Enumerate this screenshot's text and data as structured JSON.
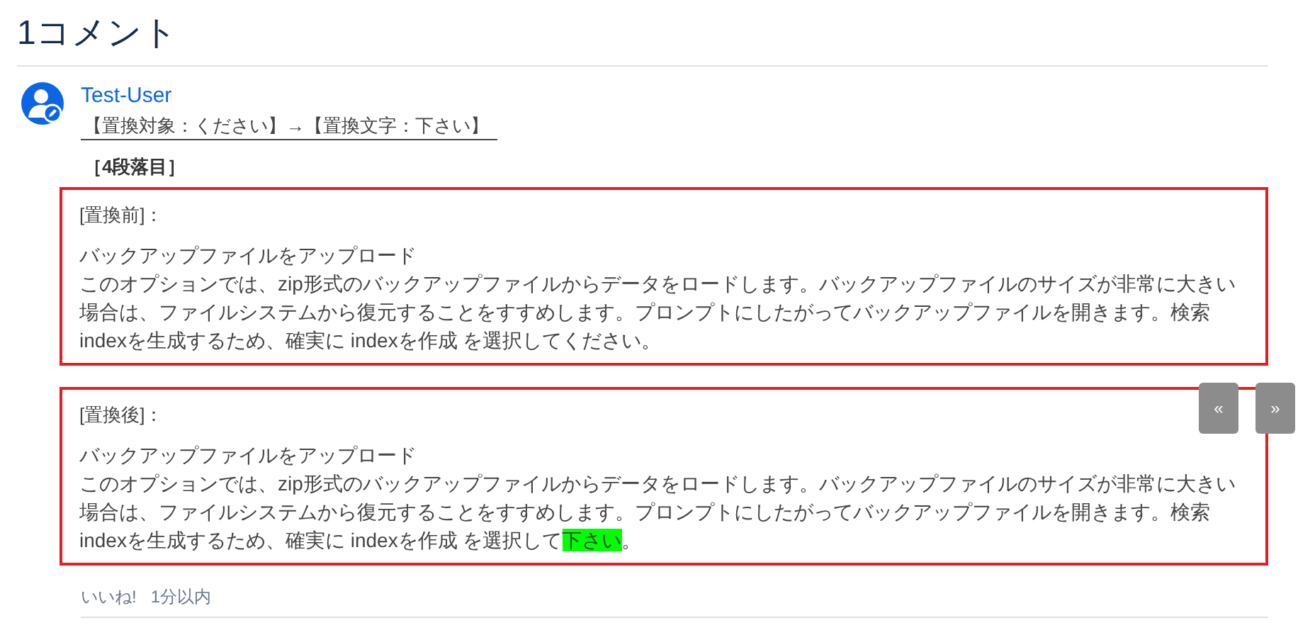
{
  "section": {
    "title": "1コメント"
  },
  "comment": {
    "author": "Test-User",
    "summary": "【置換対象：ください】→【置換文字：下さい】",
    "heading": "［4段落目］",
    "blocks": [
      {
        "label": "[置換前]：",
        "title": "バックアップファイルをアップロード",
        "lines": [
          [
            {
              "text": "このオプションでは、zip形式のバックアップファイルからデータをロードします。バックアップファイルのサイズが非常に大きい",
              "highlight": false
            }
          ],
          [
            {
              "text": "場合は、ファイルシステムから復元することをすすめします。プロンプトにしたがってバックアップファイルを開きます。検索",
              "highlight": false
            }
          ],
          [
            {
              "text": "indexを生成するため、確実に indexを作成 を選択してください。",
              "highlight": false
            }
          ]
        ]
      },
      {
        "label": "[置換後]：",
        "title": "バックアップファイルをアップロード",
        "lines": [
          [
            {
              "text": "このオプションでは、zip形式のバックアップファイルからデータをロードします。バックアップファイルのサイズが非常に大きい",
              "highlight": false
            }
          ],
          [
            {
              "text": "場合は、ファイルシステムから復元することをすすめします。プロンプトにしたがってバックアップファイルを開きます。検索",
              "highlight": false
            }
          ],
          [
            {
              "text": "indexを生成するため、確実に indexを作成 を選択して",
              "highlight": false
            },
            {
              "text": "下さい",
              "highlight": true
            },
            {
              "text": "。",
              "highlight": false
            }
          ]
        ]
      }
    ],
    "footer": {
      "like": "いいね!",
      "time": "1分以内"
    }
  },
  "nav": {
    "prev": "«",
    "next": "»"
  }
}
